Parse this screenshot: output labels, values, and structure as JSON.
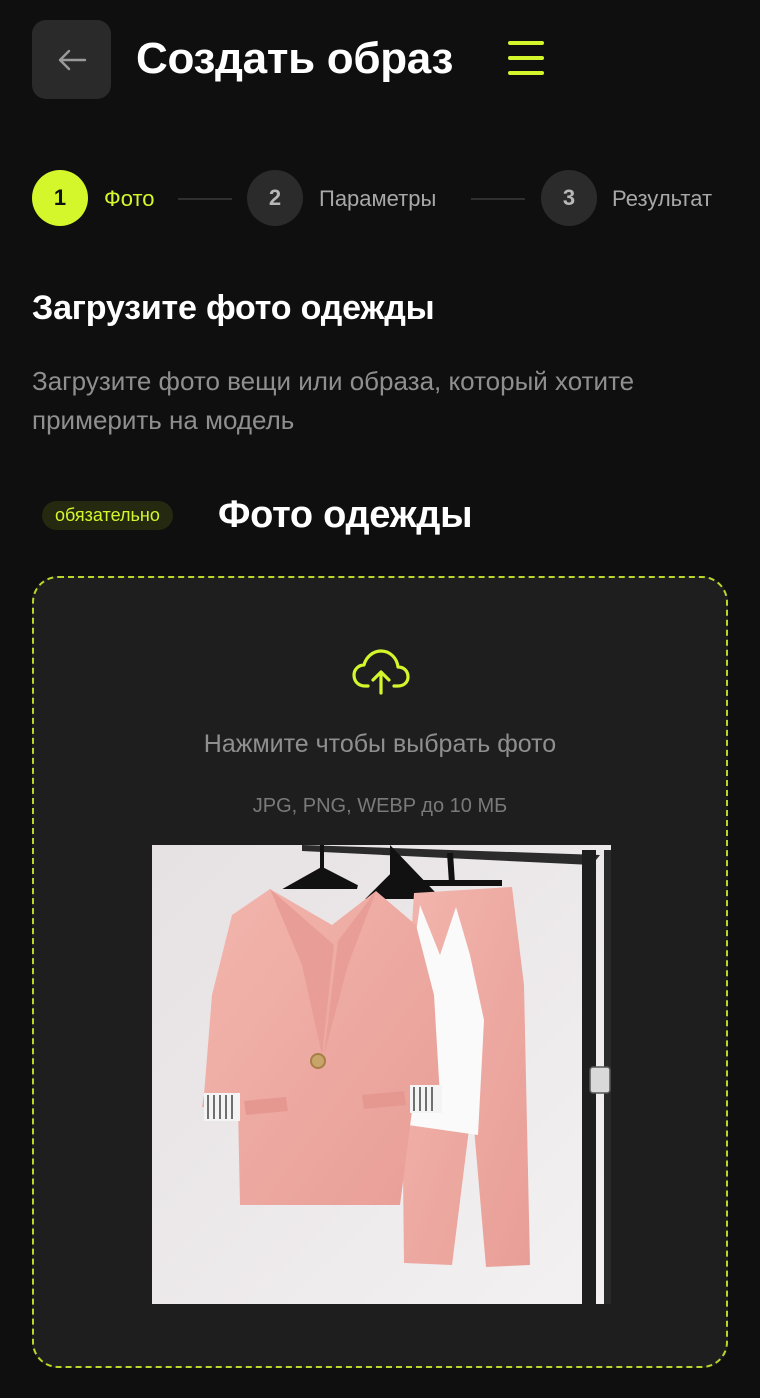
{
  "header": {
    "title": "Создать образ",
    "back_icon": "arrow-left-icon",
    "menu_icon": "hamburger-menu-icon"
  },
  "stepper": {
    "steps": [
      {
        "number": "1",
        "label": "Фото",
        "active": true
      },
      {
        "number": "2",
        "label": "Параметры",
        "active": false
      },
      {
        "number": "3",
        "label": "Результат",
        "active": false
      }
    ]
  },
  "intro": {
    "title": "Загрузите фото одежды",
    "description": "Загрузите фото вещи или образа, который хотите примерить на модель"
  },
  "upload": {
    "required_badge": "обязательно",
    "field_title": "Фото одежды",
    "hint": "Нажмите чтобы выбрать фото",
    "formats": "JPG, PNG, WEBP до 10 МБ",
    "icon": "cloud-upload-icon"
  },
  "colors": {
    "accent": "#d4f72c",
    "background": "#0f0f0f",
    "card": "#1e1e1e"
  }
}
